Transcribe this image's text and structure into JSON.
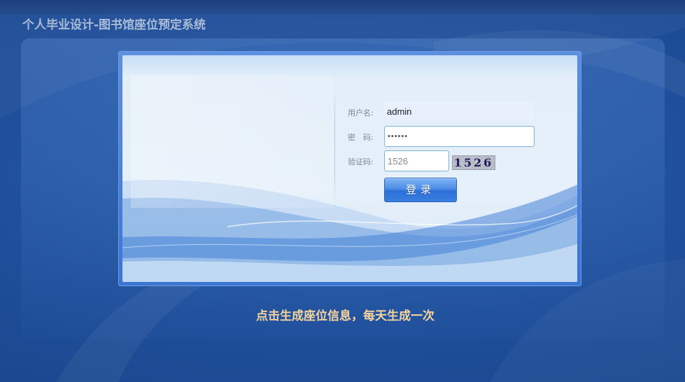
{
  "header": {
    "title": "个人毕业设计-图书馆座位预定系统"
  },
  "login": {
    "username_label": "用户名:",
    "username_value": "admin",
    "password_label": "密　码:",
    "password_value": "••••••",
    "captcha_label": "验证码:",
    "captcha_value": "1526",
    "captcha_image_text": "1526",
    "submit_label": "登录"
  },
  "footer": {
    "notice": "点击生成座位信息，每天生成一次"
  },
  "colors": {
    "background": "#1f4f9a",
    "frame_border": "#6f9fe3",
    "button": "#3a7ee0",
    "notice_text": "#f5d39e",
    "title_text": "#a9bbd6"
  }
}
